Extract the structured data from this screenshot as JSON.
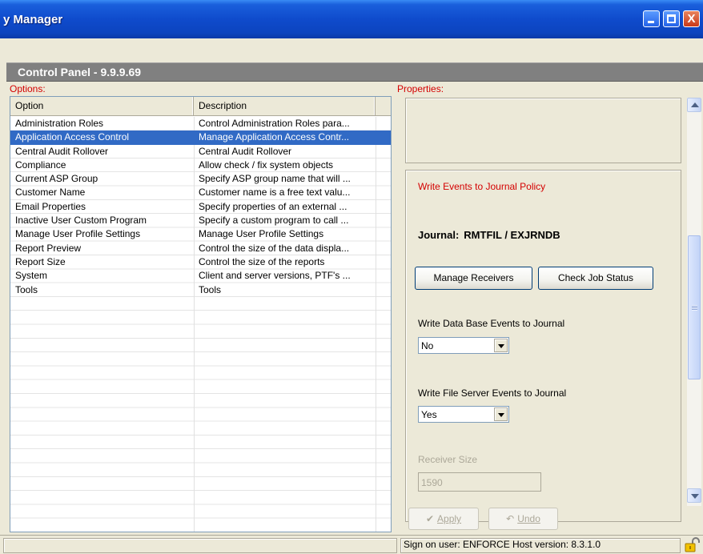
{
  "window": {
    "title": "y Manager",
    "controls": {
      "minimize": "minimize",
      "maximize": "maximize",
      "close": "X"
    }
  },
  "panel": {
    "title": "Control Panel - 9.9.9.69"
  },
  "options": {
    "label": "Options:",
    "columns": [
      "Option",
      "Description"
    ],
    "rows": [
      {
        "option": "Administration Roles",
        "description": "Control Administration Roles para...",
        "selected": false
      },
      {
        "option": "Application Access Control",
        "description": "Manage Application Access Contr...",
        "selected": true
      },
      {
        "option": "Central Audit Rollover",
        "description": "Central Audit Rollover",
        "selected": false
      },
      {
        "option": "Compliance",
        "description": "Allow check / fix system objects",
        "selected": false
      },
      {
        "option": "Current ASP Group",
        "description": "Specify ASP group name that will ...",
        "selected": false
      },
      {
        "option": "Customer Name",
        "description": "Customer name is a free text valu...",
        "selected": false
      },
      {
        "option": "Email Properties",
        "description": "Specify properties of an external ...",
        "selected": false
      },
      {
        "option": "Inactive User Custom Program",
        "description": "Specify a custom program to call ...",
        "selected": false
      },
      {
        "option": "Manage User Profile Settings",
        "description": "Manage User Profile Settings",
        "selected": false
      },
      {
        "option": "Report Preview",
        "description": "Control the size of the data displa...",
        "selected": false
      },
      {
        "option": "Report Size",
        "description": "Control the size of the reports",
        "selected": false
      },
      {
        "option": "System",
        "description": "Client and server versions, PTF's ...",
        "selected": false
      },
      {
        "option": "Tools",
        "description": "Tools",
        "selected": false
      }
    ]
  },
  "properties": {
    "label": "Properties:",
    "policy_title": "Write Events to Journal Policy",
    "journal_label": "Journal:",
    "journal_value": "RMTFIL / EXJRNDB",
    "manage_receivers_label": "Manage Receivers",
    "check_job_status_label": "Check Job Status",
    "db_events_label": "Write Data Base Events to Journal",
    "db_events_value": "No",
    "fs_events_label": "Write File Server Events to Journal",
    "fs_events_value": "Yes",
    "receiver_size_label": "Receiver Size",
    "receiver_size_value": "1590"
  },
  "actions": {
    "apply_label": "Apply",
    "undo_label": "Undo"
  },
  "status": {
    "text": "Sign on user: ENFORCE Host version: 8.3.1.0"
  },
  "colors": {
    "accent": "#316ac5",
    "label_red": "#d40000",
    "titlebar": "#0f4bcc"
  }
}
